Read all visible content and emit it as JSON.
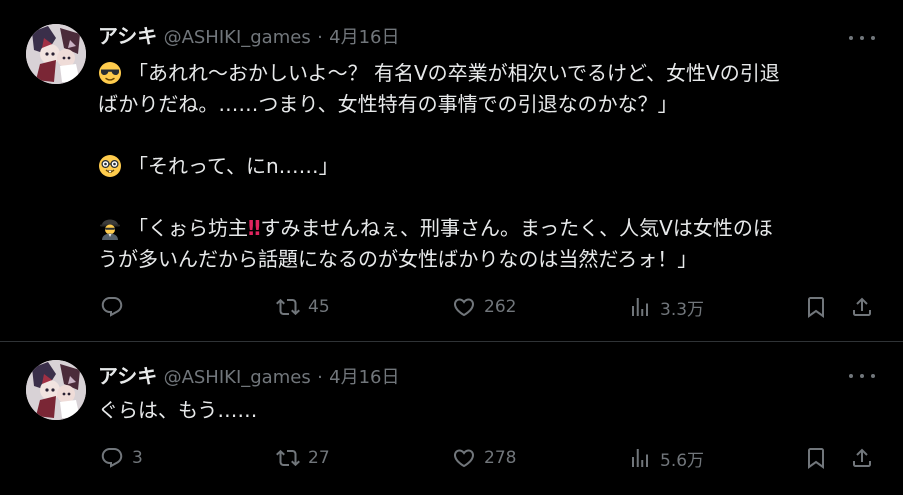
{
  "tweets": [
    {
      "author_name": "アシキ",
      "handle": "@ASHIKI_games",
      "separator": "·",
      "date": "4月16日",
      "lines": {
        "l1": "「あれれ～おかしいよ～？ 有名Vの卒業が相次いでるけど、女性Vの引退",
        "l2": "ばかりだね。……つまり、女性特有の事情での引退なのかな？」",
        "l3": "「それって、にn……」",
        "l4a": "「くぉら坊主",
        "l4bang": "‼",
        "l4b": "すみませんねぇ、刑事さん。まったく、人気Vは女性のほ",
        "l5": "うが多いんだから話題になるのが女性ばかりなのは当然だろォ！」"
      },
      "emojis": [
        "sunglasses-face-emoji",
        "nerd-face-emoji",
        "detective-emoji"
      ],
      "stats": {
        "replies": "",
        "retweets": "45",
        "likes": "262",
        "views": "3.3万"
      }
    },
    {
      "author_name": "アシキ",
      "handle": "@ASHIKI_games",
      "separator": "·",
      "date": "4月16日",
      "lines": {
        "l1": "ぐらは、もう……"
      },
      "stats": {
        "replies": "3",
        "retweets": "27",
        "likes": "278",
        "views": "5.6万"
      }
    }
  ],
  "colors": {
    "background": "#000000",
    "text": "#e7e9ea",
    "muted": "#71767b",
    "divider": "#2f3336"
  }
}
